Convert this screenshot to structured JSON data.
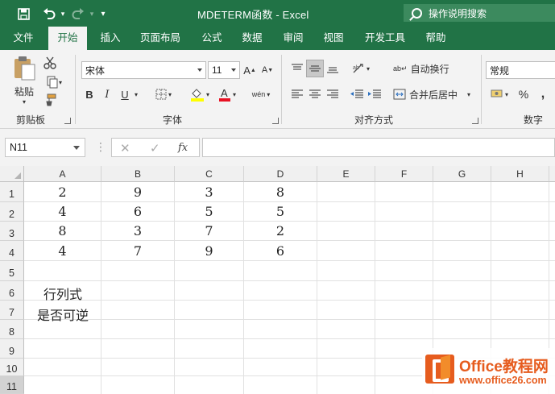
{
  "window": {
    "title": "MDETERM函数 - Excel"
  },
  "tell_me": {
    "label": "操作说明搜索"
  },
  "tabs": [
    {
      "label": "文件"
    },
    {
      "label": "开始"
    },
    {
      "label": "插入"
    },
    {
      "label": "页面布局"
    },
    {
      "label": "公式"
    },
    {
      "label": "数据"
    },
    {
      "label": "审阅"
    },
    {
      "label": "视图"
    },
    {
      "label": "开发工具"
    },
    {
      "label": "帮助"
    }
  ],
  "ribbon": {
    "clipboard": {
      "label": "剪贴板",
      "paste": "粘贴"
    },
    "font": {
      "label": "字体",
      "name": "宋体",
      "size": "11",
      "bold": "B",
      "italic": "I",
      "underline": "U"
    },
    "alignment": {
      "label": "对齐方式",
      "wrap": "自动换行",
      "merge": "合并后居中"
    },
    "number": {
      "label": "数字",
      "format": "常规",
      "percent": "%"
    }
  },
  "formula_bar": {
    "name_box": "N11",
    "fx": "fx",
    "cancel": "✕",
    "enter": "✓",
    "value": ""
  },
  "columns": [
    "A",
    "B",
    "C",
    "D",
    "E",
    "F",
    "G",
    "H"
  ],
  "rows": [
    "1",
    "2",
    "3",
    "4",
    "5",
    "6",
    "7",
    "8",
    "9",
    "10",
    "11"
  ],
  "cells": [
    [
      "2",
      "9",
      "3",
      "8"
    ],
    [
      "4",
      "6",
      "5",
      "5"
    ],
    [
      "8",
      "3",
      "7",
      "2"
    ],
    [
      "4",
      "7",
      "9",
      "6"
    ]
  ],
  "labels": {
    "line1": "行列式",
    "line2": "是否可逆"
  },
  "watermark": {
    "brand": "Office教程网",
    "url": "www.office26.com"
  }
}
